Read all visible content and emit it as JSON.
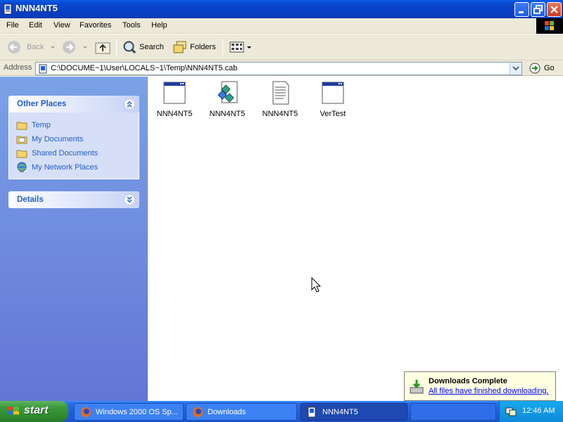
{
  "window": {
    "title": "NNN4NT5"
  },
  "menu": {
    "items": [
      "File",
      "Edit",
      "View",
      "Favorites",
      "Tools",
      "Help"
    ]
  },
  "toolbar": {
    "back": "Back",
    "search": "Search",
    "folders": "Folders"
  },
  "address": {
    "label": "Address",
    "value": "C:\\DOCUME~1\\User\\LOCALS~1\\Temp\\NNN4NT5.cab",
    "go": "Go"
  },
  "sidebar": {
    "other_places": {
      "title": "Other Places",
      "items": [
        {
          "label": "Temp",
          "icon": "folder-icon"
        },
        {
          "label": "My Documents",
          "icon": "my-documents-icon"
        },
        {
          "label": "Shared Documents",
          "icon": "folder-icon"
        },
        {
          "label": "My Network Places",
          "icon": "network-places-icon"
        }
      ]
    },
    "details": {
      "title": "Details"
    }
  },
  "files": [
    {
      "name": "NNN4NT5",
      "icon": "application-icon"
    },
    {
      "name": "NNN4NT5",
      "icon": "setup-package-icon"
    },
    {
      "name": "NNN4NT5",
      "icon": "text-document-icon"
    },
    {
      "name": "VerTest",
      "icon": "application-icon"
    }
  ],
  "notification": {
    "title": "Downloads Complete",
    "message": "All files have finished downloading."
  },
  "taskbar": {
    "start": "start",
    "tasks": [
      {
        "label": "Windows 2000 OS Sp...",
        "icon": "firefox-icon"
      },
      {
        "label": "Downloads",
        "icon": "firefox-icon"
      },
      {
        "label": "NNN4NT5",
        "icon": "explorer-icon"
      }
    ],
    "clock": "12:46 AM"
  },
  "colors": {
    "title_bar": "#0a48d0",
    "taskbar": "#245edb",
    "start_button": "#3c9a3c",
    "task_pane": "#6375d6",
    "link": "#215dc6"
  }
}
